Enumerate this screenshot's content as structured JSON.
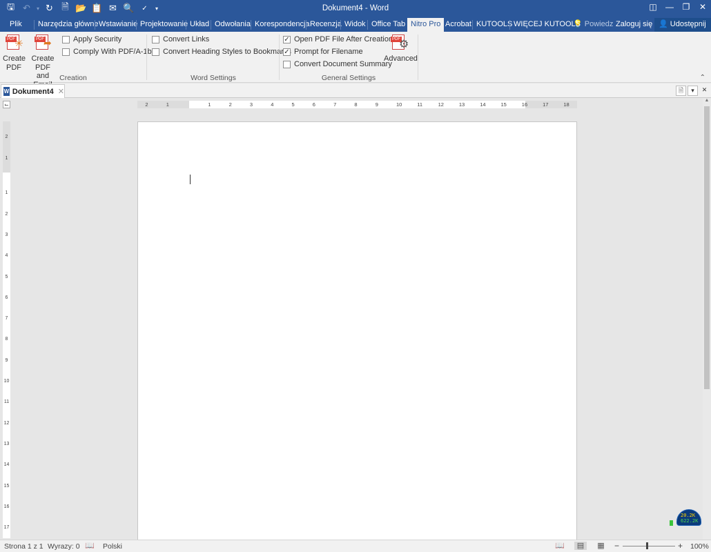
{
  "window": {
    "title": "Dokument4 - Word"
  },
  "qat": {
    "icons": [
      "save-icon",
      "undo-icon",
      "redo-icon",
      "new-document-icon",
      "open-icon",
      "clipboard-icon",
      "share-icon",
      "print-preview-icon",
      "spelling-icon",
      "customize-icon"
    ]
  },
  "tabs": [
    {
      "label": "Plik"
    },
    {
      "label": "Narzędzia główne"
    },
    {
      "label": "Wstawianie"
    },
    {
      "label": "Projektowanie"
    },
    {
      "label": "Układ"
    },
    {
      "label": "Odwołania"
    },
    {
      "label": "Korespondencja"
    },
    {
      "label": "Recenzja"
    },
    {
      "label": "Widok"
    },
    {
      "label": "Office Tab"
    },
    {
      "label": "Nitro Pro",
      "active": true
    },
    {
      "label": "Acrobat"
    },
    {
      "label": "KUTOOLS"
    },
    {
      "label": "WIĘCEJ KUTOOLS"
    }
  ],
  "tellme": {
    "label": "Powiedz r"
  },
  "account": {
    "signin": "Zaloguj się",
    "share": "Udostępnij"
  },
  "ribbon": {
    "creation": {
      "create_pdf": [
        "Create",
        "PDF"
      ],
      "create_pdf_email": [
        "Create PDF",
        "and Email"
      ],
      "apply_security": {
        "label": "Apply Security",
        "checked": false
      },
      "comply_pdfa": {
        "label": "Comply With PDF/A-1b",
        "checked": false
      },
      "group_label": "Creation"
    },
    "word_settings": {
      "convert_links": {
        "label": "Convert Links",
        "checked": false
      },
      "convert_heading": {
        "label": "Convert Heading Styles to Bookmarks",
        "checked": false
      },
      "group_label": "Word Settings"
    },
    "general_settings": {
      "open_pdf": {
        "label": "Open PDF File After Creation",
        "checked": true
      },
      "prompt_filename": {
        "label": "Prompt for Filename",
        "checked": true
      },
      "convert_summary": {
        "label": "Convert Document Summary",
        "checked": false
      },
      "advanced": "Advanced",
      "group_label": "General Settings"
    }
  },
  "doctab": {
    "name": "Dokument4"
  },
  "ruler": {
    "h_labels": [
      "2",
      "1",
      "1",
      "2",
      "3",
      "4",
      "5",
      "6",
      "7",
      "8",
      "9",
      "10",
      "11",
      "12",
      "13",
      "14",
      "15",
      "16",
      "17",
      "18"
    ],
    "v_labels": [
      "2",
      "1",
      "1",
      "2",
      "3",
      "4",
      "5",
      "6",
      "7",
      "8",
      "9",
      "10",
      "11",
      "12",
      "13",
      "14",
      "15",
      "16",
      "17"
    ]
  },
  "widget": {
    "line1": "20.2K",
    "line2": "622.2K"
  },
  "status": {
    "page": "Strona 1 z 1",
    "words": "Wyrazy: 0",
    "language": "Polski",
    "zoom": "100%",
    "zoom_level": 100
  },
  "colors": {
    "accent": "#2b579a",
    "ribbon_bg": "#f1f1f1",
    "canvas_bg": "#e6e6e6"
  }
}
